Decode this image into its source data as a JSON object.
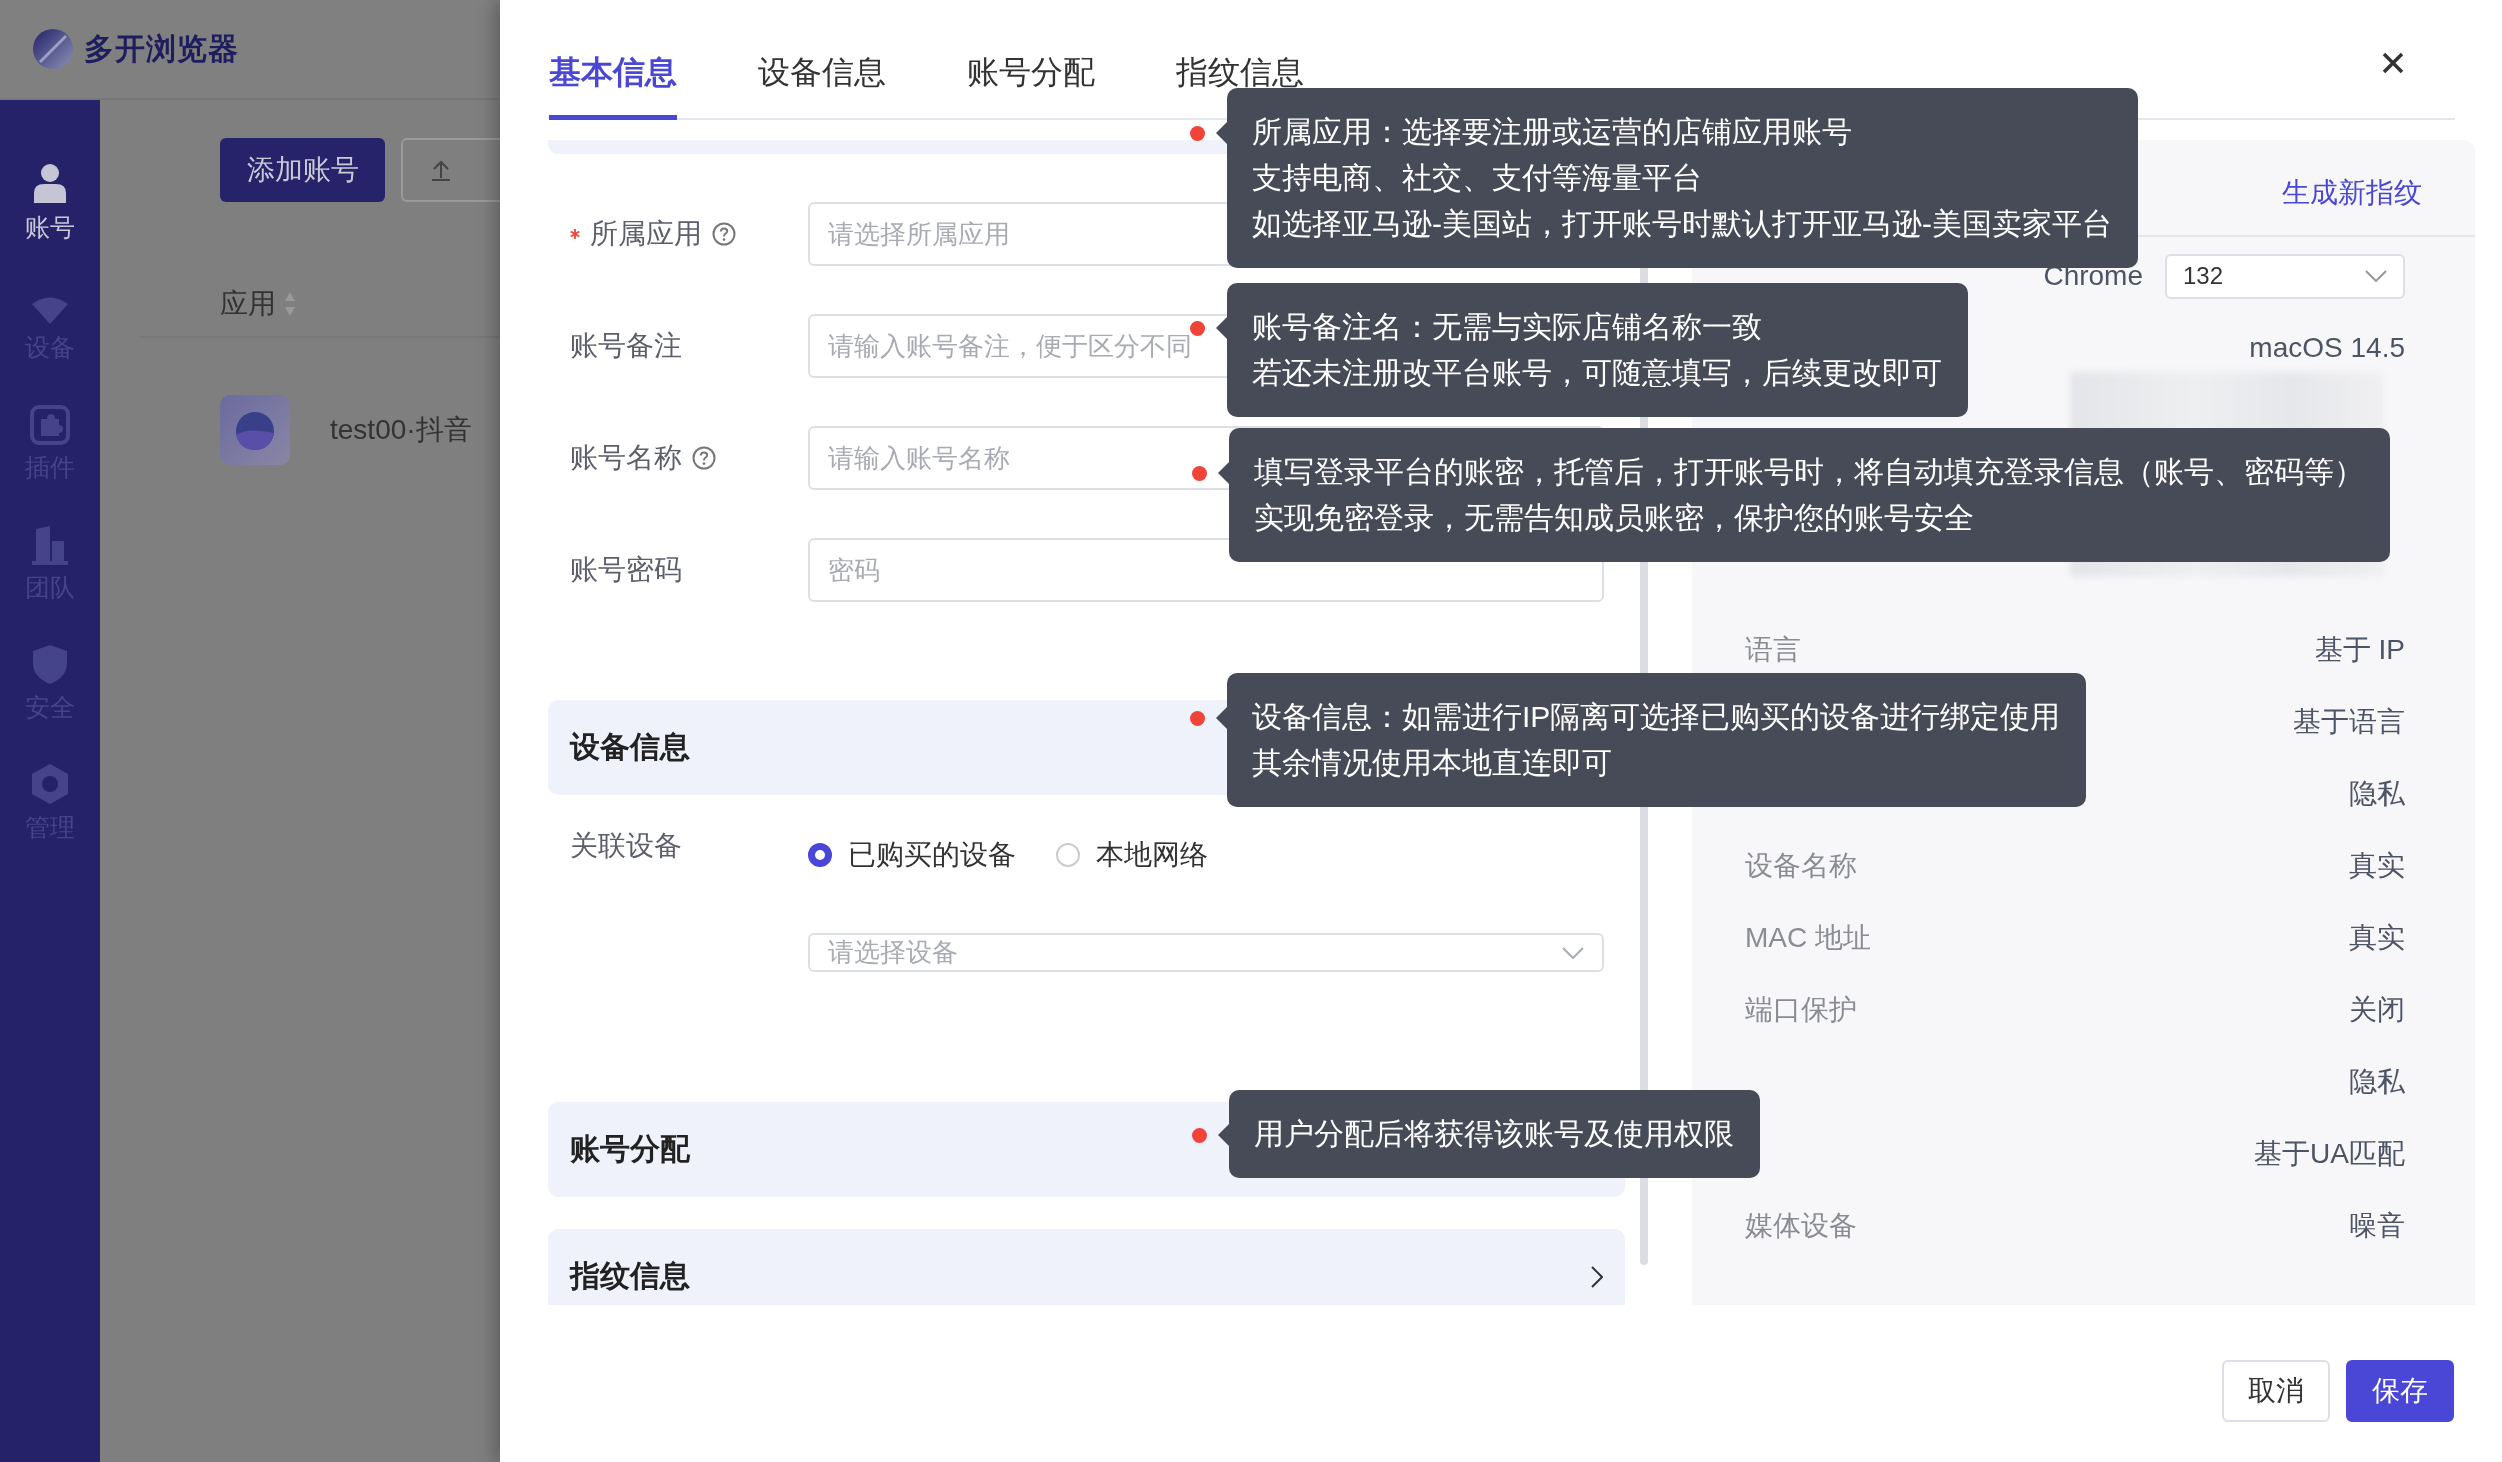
{
  "app": {
    "logo": "多开浏览器",
    "nav": [
      {
        "label": "账号",
        "selected": true
      },
      {
        "label": "设备",
        "selected": false
      },
      {
        "label": "插件",
        "selected": false
      },
      {
        "label": "团队",
        "selected": false
      },
      {
        "label": "安全",
        "selected": false
      },
      {
        "label": "管理",
        "selected": false
      }
    ],
    "add_button": "添加账号",
    "table": {
      "column": "应用",
      "row": "test00·抖音"
    }
  },
  "drawer": {
    "tabs": [
      {
        "label": "基本信息",
        "selected": true
      },
      {
        "label": "设备信息",
        "selected": false
      },
      {
        "label": "账号分配",
        "selected": false
      },
      {
        "label": "指纹信息",
        "selected": false
      }
    ],
    "fields": [
      {
        "label": "所属应用",
        "required": true,
        "help": true,
        "placeholder": "请选择所属应用"
      },
      {
        "label": "账号备注",
        "required": false,
        "help": false,
        "placeholder": "请输入账号备注，便于区分不同"
      },
      {
        "label": "账号名称",
        "required": false,
        "help": true,
        "placeholder": "请输入账号名称"
      },
      {
        "label": "账号密码",
        "required": false,
        "help": false,
        "placeholder": "密码"
      }
    ],
    "device": {
      "title": "设备信息",
      "label": "关联设备",
      "options": [
        {
          "label": "已购买的设备",
          "selected": true
        },
        {
          "label": "本地网络",
          "selected": false
        }
      ],
      "placeholder": "请选择设备"
    },
    "sections": [
      {
        "title": "账号分配"
      },
      {
        "title": "指纹信息"
      }
    ],
    "summary": {
      "action": "生成新指纹",
      "rows": [
        {
          "kind": "browser",
          "name": "Chrome",
          "version": "132"
        },
        {
          "kind": "text",
          "value": "macOS 14.5"
        },
        {
          "kind": "ua"
        },
        {
          "kind": "text",
          "label": "语言",
          "value": "基于 IP"
        },
        {
          "kind": "text",
          "value": "基于语言"
        },
        {
          "kind": "text",
          "value": "隐私"
        },
        {
          "kind": "text",
          "label": "设备名称",
          "value": "真实"
        },
        {
          "kind": "text",
          "label": "MAC 地址",
          "value": "真实"
        },
        {
          "kind": "text",
          "label": "端口保护",
          "value": "关闭"
        },
        {
          "kind": "text",
          "value": "隐私"
        },
        {
          "kind": "text",
          "value": "基于UA匹配"
        },
        {
          "kind": "text",
          "label": "媒体设备",
          "value": "噪音"
        }
      ]
    },
    "footer": {
      "cancel": "取消",
      "save": "保存"
    }
  },
  "hints": [
    {
      "lines": [
        "所属应用：选择要注册或运营的店铺应用账号",
        "支持电商、社交、支付等海量平台",
        "如选择亚马逊-美国站，打开账号时默认打开亚马逊-美国卖家平台"
      ]
    },
    {
      "lines": [
        "账号备注名：无需与实际店铺名称一致",
        "若还未注册改平台账号，可随意填写，后续更改即可"
      ]
    },
    {
      "lines": [
        "填写登录平台的账密，托管后，打开账号时，将自动填充登录信息（账号、密码等）",
        "实现免密登录，无需告知成员账密，保护您的账号安全"
      ]
    },
    {
      "lines": [
        "设备信息：如需进行IP隔离可选择已购买的设备进行绑定使用",
        "其余情况使用本地直连即可"
      ]
    },
    {
      "lines": [
        "用户分配后将获得该账号及使用权限"
      ]
    }
  ]
}
